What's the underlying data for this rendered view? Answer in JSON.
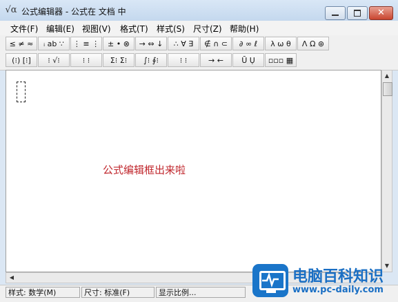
{
  "window": {
    "app_icon": "√α",
    "title": "公式编辑器 - 公式在 文档 中",
    "controls": [
      "minimize-icon",
      "maximize-icon",
      "close-icon"
    ]
  },
  "menu": [
    "文件(F)",
    "编辑(E)",
    "视图(V)",
    "格式(T)",
    "样式(S)",
    "尺寸(Z)",
    "帮助(H)"
  ],
  "toolbar": {
    "row1": [
      "≤ ≠ ≈",
      "ᵢ ab ∵",
      "⋮ ≡ ⋮",
      "± • ⊗",
      "→ ⇔ ↓",
      "∴ ∀ ∃",
      "∉ ∩ ⊂",
      "∂ ∞ ℓ",
      "λ ω θ",
      "Λ Ω ⊛"
    ],
    "row2": [
      "(⁝) [⁝]",
      "⁝ √⁝",
      "⁝ ⁝",
      "Σ⁝ Σ⁝",
      "∫⁝ ∮⁝",
      "⁝ ⁝",
      "→ ←",
      "Ū Ụ",
      "▫▫▫ ▦"
    ]
  },
  "editor": {
    "annotation": "公式编辑框出来啦"
  },
  "status": {
    "style": "样式: 数学(M)",
    "size": "尺寸: 标准(F)",
    "zoom": "显示比例..."
  },
  "watermark": {
    "title": "电脑百科知识",
    "url": "www.pc-daily.com"
  },
  "colors": {
    "annotation": "#c0272d",
    "watermark": "#1a6fc4"
  }
}
